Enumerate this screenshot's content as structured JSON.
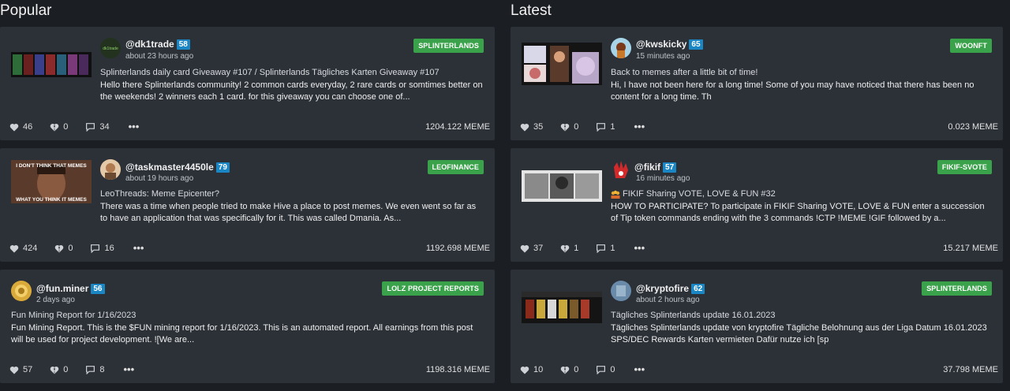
{
  "popular": {
    "title": "Popular",
    "posts": [
      {
        "author": "@dk1trade",
        "rep": "58",
        "time": "about 23 hours ago",
        "tag": "SPLINTERLANDS",
        "title": "Splinterlands daily card Giveaway #107 / Splinterlands Tägliches Karten Giveaway #107",
        "excerpt": "Hello there Splinterlands community! 2 common cards everyday, 2 rare cards or somtimes better on the weekends! 2 winners each 1 card. for this giveaway you can choose one of...",
        "likes": "46",
        "dislikes": "0",
        "comments": "34",
        "meme": "1204.122 MEME",
        "avatar_label": "dk1trade"
      },
      {
        "author": "@taskmaster4450le",
        "rep": "79",
        "time": "about 19 hours ago",
        "tag": "LEOFINANCE",
        "title": "LeoThreads: Meme Epicenter?",
        "excerpt": "There was a time when people tried to make Hive a place to post memes. We even went so far as to have an application that was specifically for it. This was called Dmania. As...",
        "likes": "424",
        "dislikes": "0",
        "comments": "16",
        "meme": "1192.698 MEME",
        "thumb_top": "I DON'T THINK THAT MEMES",
        "thumb_bottom": "WHAT YOU THINK IT MEMES"
      },
      {
        "author": "@fun.miner",
        "rep": "56",
        "time": "2 days ago",
        "tag": "LOLZ PROJECT REPORTS",
        "title": "Fun Mining Report for 1/16/2023",
        "excerpt": "Fun Mining Report. This is the $FUN mining report for 1/16/2023. This is an automated report. All earnings from this post will be used for project development. ![We are...",
        "likes": "57",
        "dislikes": "0",
        "comments": "8",
        "meme": "1198.316 MEME"
      }
    ]
  },
  "latest": {
    "title": "Latest",
    "posts": [
      {
        "author": "@kwskicky",
        "rep": "65",
        "time": "15 minutes ago",
        "tag": "WOONFT",
        "title": "Back to memes after a little bit of time!",
        "excerpt": "Hi, I have not been here for a long time! Some of you may have noticed that there has been no content for a long time. Th",
        "likes": "35",
        "dislikes": "0",
        "comments": "1",
        "meme": "0.023 MEME"
      },
      {
        "author": "@fikif",
        "rep": "57",
        "time": "16 minutes ago",
        "tag": "FIKIF-SVOTE",
        "title": "FIKIF Sharing VOTE, LOVE & FUN #32",
        "excerpt": "HOW TO PARTICIPATE? To participate in FIKIF Sharing VOTE, LOVE & FUN enter a succession of Tip token commands ending with the 3 commands !CTP !MEME !GIF followed by a...",
        "likes": "37",
        "dislikes": "1",
        "comments": "1",
        "meme": "15.217 MEME"
      },
      {
        "author": "@kryptofire",
        "rep": "62",
        "time": "about 2 hours ago",
        "tag": "SPLINTERLANDS",
        "title": "Tägliches Splinterlands update 16.01.2023",
        "excerpt": "Tägliches Splinterlands update von kryptofire Tägliche Belohnung aus der Liga Datum 16.01.2023 SPS/DEC Rewards Karten vermieten Dafür nutze ich [sp",
        "likes": "10",
        "dislikes": "0",
        "comments": "0",
        "meme": "37.798 MEME"
      }
    ]
  }
}
